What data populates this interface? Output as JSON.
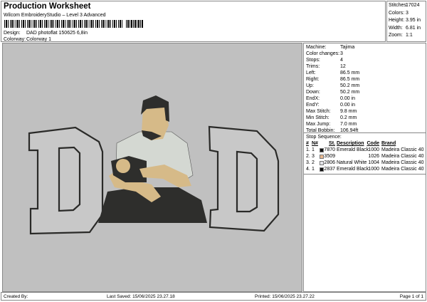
{
  "header": {
    "title": "Production Worksheet",
    "subtitle": "Wilcom EmbroideryStudio – Level 3 Advanced",
    "design_label": "Design:",
    "design_value": "DAD photoflat 150625 6,8in",
    "colorway_label": "Colorway:",
    "colorway_value": "Colorway 1"
  },
  "stats": [
    {
      "k": "Stitches:",
      "v": "17024"
    },
    {
      "k": "Colors:",
      "v": "3"
    },
    {
      "k": "Height:",
      "v": "3.95 in"
    },
    {
      "k": "Width:",
      "v": "6.81 in"
    },
    {
      "k": "Zoom:",
      "v": "1:1"
    }
  ],
  "info": [
    {
      "k": "Machine:",
      "v": "Tajima"
    },
    {
      "k": "Color changes:",
      "v": "3"
    },
    {
      "k": "Stops:",
      "v": "4"
    },
    {
      "k": "Trims:",
      "v": "12"
    },
    {
      "k": "Left:",
      "v": "86.5 mm"
    },
    {
      "k": "Right:",
      "v": "86.5 mm"
    },
    {
      "k": "Up:",
      "v": "50.2 mm"
    },
    {
      "k": "Down:",
      "v": "50.2 mm"
    },
    {
      "k": "EndX:",
      "v": "0.00 in"
    },
    {
      "k": "EndY:",
      "v": "0.00 in"
    },
    {
      "k": "Max Stitch:",
      "v": "9.8 mm"
    },
    {
      "k": "Min Stitch:",
      "v": "0.2 mm"
    },
    {
      "k": "Max Jump:",
      "v": "7.0 mm"
    },
    {
      "k": "Total Bobbin:",
      "v": "106.94ft"
    }
  ],
  "stop_sequence": {
    "title": "Stop Sequence:",
    "headers": [
      "#",
      "N#",
      "St.",
      "Description",
      "Code",
      "Brand"
    ],
    "rows": [
      {
        "n": "1.",
        "needle": "1",
        "color": "#111111",
        "st": "7870",
        "desc": "Emerald Black",
        "code": "1000",
        "brand": "Madeira Classic 40"
      },
      {
        "n": "2.",
        "needle": "3",
        "color": "#e8b890",
        "st": "3509",
        "desc": "",
        "code": "1026",
        "brand": "Madeira Classic 40"
      },
      {
        "n": "3.",
        "needle": "2",
        "color": "#e4e4e8",
        "st": "2806",
        "desc": "Natural White",
        "code": "1004",
        "brand": "Madeira Classic 40"
      },
      {
        "n": "4.",
        "needle": "1",
        "color": "#111111",
        "st": "2837",
        "desc": "Emerald Black",
        "code": "1000",
        "brand": "Madeira Classic 40"
      }
    ]
  },
  "footer": {
    "created": "Created By:",
    "saved": "Last Saved: 15/06/2025 23.27.18",
    "printed": "Printed: 15/06/2025 23.27.22",
    "page": "Page 1 of 1"
  },
  "colors": {
    "background": "#c0c0c0",
    "thread_black": "#2a2a28",
    "skin": "#d9bf8c",
    "shirt": "#d8dcd8"
  }
}
